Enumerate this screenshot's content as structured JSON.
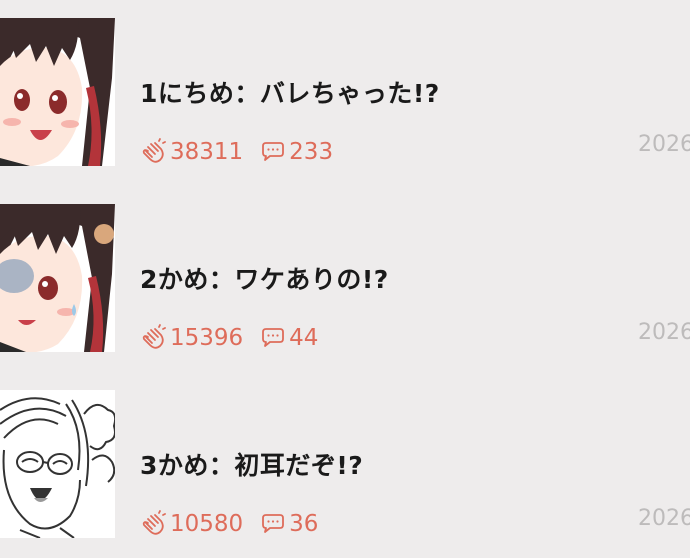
{
  "episodes": [
    {
      "title": "1にちめ：バレちゃった!?",
      "claps": "38311",
      "comments": "233",
      "date": "2026"
    },
    {
      "title": "2かめ：ワケありの!?",
      "claps": "15396",
      "comments": "44",
      "date": "2026"
    },
    {
      "title": "3かめ：初耳だぞ!?",
      "claps": "10580",
      "comments": "36",
      "date": "2026"
    }
  ],
  "colors": {
    "background": "#eeecec",
    "accent": "#de6c5a",
    "title": "#1a1a1a",
    "date": "#bdbbbb"
  },
  "icons": {
    "clap": "clap-icon",
    "comment": "comment-bubble-icon"
  }
}
